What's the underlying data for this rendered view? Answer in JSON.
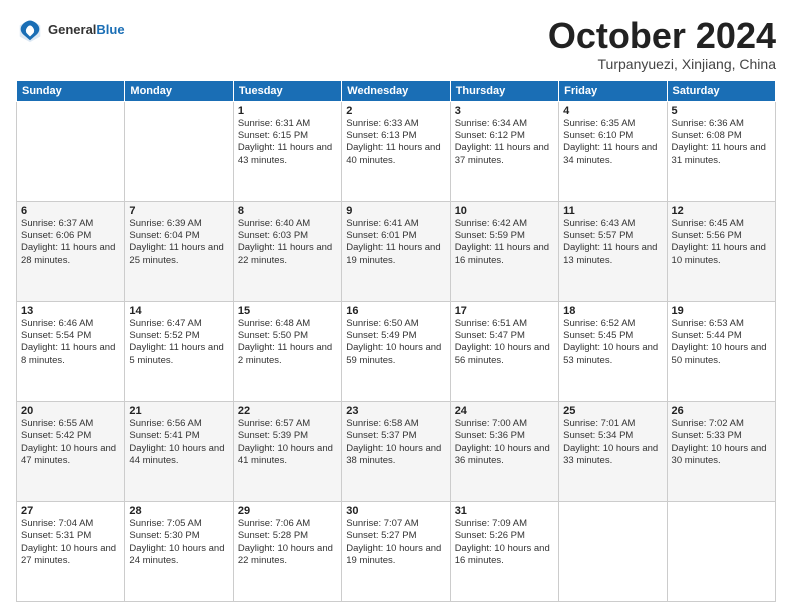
{
  "logo": {
    "general": "General",
    "blue": "Blue"
  },
  "header": {
    "month": "October 2024",
    "location": "Turpanyuezi, Xinjiang, China"
  },
  "weekdays": [
    "Sunday",
    "Monday",
    "Tuesday",
    "Wednesday",
    "Thursday",
    "Friday",
    "Saturday"
  ],
  "weeks": [
    [
      null,
      null,
      {
        "day": "1",
        "sunrise": "6:31 AM",
        "sunset": "6:15 PM",
        "daylight": "11 hours and 43 minutes."
      },
      {
        "day": "2",
        "sunrise": "6:33 AM",
        "sunset": "6:13 PM",
        "daylight": "11 hours and 40 minutes."
      },
      {
        "day": "3",
        "sunrise": "6:34 AM",
        "sunset": "6:12 PM",
        "daylight": "11 hours and 37 minutes."
      },
      {
        "day": "4",
        "sunrise": "6:35 AM",
        "sunset": "6:10 PM",
        "daylight": "11 hours and 34 minutes."
      },
      {
        "day": "5",
        "sunrise": "6:36 AM",
        "sunset": "6:08 PM",
        "daylight": "11 hours and 31 minutes."
      }
    ],
    [
      {
        "day": "6",
        "sunrise": "6:37 AM",
        "sunset": "6:06 PM",
        "daylight": "11 hours and 28 minutes."
      },
      {
        "day": "7",
        "sunrise": "6:39 AM",
        "sunset": "6:04 PM",
        "daylight": "11 hours and 25 minutes."
      },
      {
        "day": "8",
        "sunrise": "6:40 AM",
        "sunset": "6:03 PM",
        "daylight": "11 hours and 22 minutes."
      },
      {
        "day": "9",
        "sunrise": "6:41 AM",
        "sunset": "6:01 PM",
        "daylight": "11 hours and 19 minutes."
      },
      {
        "day": "10",
        "sunrise": "6:42 AM",
        "sunset": "5:59 PM",
        "daylight": "11 hours and 16 minutes."
      },
      {
        "day": "11",
        "sunrise": "6:43 AM",
        "sunset": "5:57 PM",
        "daylight": "11 hours and 13 minutes."
      },
      {
        "day": "12",
        "sunrise": "6:45 AM",
        "sunset": "5:56 PM",
        "daylight": "11 hours and 10 minutes."
      }
    ],
    [
      {
        "day": "13",
        "sunrise": "6:46 AM",
        "sunset": "5:54 PM",
        "daylight": "11 hours and 8 minutes."
      },
      {
        "day": "14",
        "sunrise": "6:47 AM",
        "sunset": "5:52 PM",
        "daylight": "11 hours and 5 minutes."
      },
      {
        "day": "15",
        "sunrise": "6:48 AM",
        "sunset": "5:50 PM",
        "daylight": "11 hours and 2 minutes."
      },
      {
        "day": "16",
        "sunrise": "6:50 AM",
        "sunset": "5:49 PM",
        "daylight": "10 hours and 59 minutes."
      },
      {
        "day": "17",
        "sunrise": "6:51 AM",
        "sunset": "5:47 PM",
        "daylight": "10 hours and 56 minutes."
      },
      {
        "day": "18",
        "sunrise": "6:52 AM",
        "sunset": "5:45 PM",
        "daylight": "10 hours and 53 minutes."
      },
      {
        "day": "19",
        "sunrise": "6:53 AM",
        "sunset": "5:44 PM",
        "daylight": "10 hours and 50 minutes."
      }
    ],
    [
      {
        "day": "20",
        "sunrise": "6:55 AM",
        "sunset": "5:42 PM",
        "daylight": "10 hours and 47 minutes."
      },
      {
        "day": "21",
        "sunrise": "6:56 AM",
        "sunset": "5:41 PM",
        "daylight": "10 hours and 44 minutes."
      },
      {
        "day": "22",
        "sunrise": "6:57 AM",
        "sunset": "5:39 PM",
        "daylight": "10 hours and 41 minutes."
      },
      {
        "day": "23",
        "sunrise": "6:58 AM",
        "sunset": "5:37 PM",
        "daylight": "10 hours and 38 minutes."
      },
      {
        "day": "24",
        "sunrise": "7:00 AM",
        "sunset": "5:36 PM",
        "daylight": "10 hours and 36 minutes."
      },
      {
        "day": "25",
        "sunrise": "7:01 AM",
        "sunset": "5:34 PM",
        "daylight": "10 hours and 33 minutes."
      },
      {
        "day": "26",
        "sunrise": "7:02 AM",
        "sunset": "5:33 PM",
        "daylight": "10 hours and 30 minutes."
      }
    ],
    [
      {
        "day": "27",
        "sunrise": "7:04 AM",
        "sunset": "5:31 PM",
        "daylight": "10 hours and 27 minutes."
      },
      {
        "day": "28",
        "sunrise": "7:05 AM",
        "sunset": "5:30 PM",
        "daylight": "10 hours and 24 minutes."
      },
      {
        "day": "29",
        "sunrise": "7:06 AM",
        "sunset": "5:28 PM",
        "daylight": "10 hours and 22 minutes."
      },
      {
        "day": "30",
        "sunrise": "7:07 AM",
        "sunset": "5:27 PM",
        "daylight": "10 hours and 19 minutes."
      },
      {
        "day": "31",
        "sunrise": "7:09 AM",
        "sunset": "5:26 PM",
        "daylight": "10 hours and 16 minutes."
      },
      null,
      null
    ]
  ],
  "labels": {
    "sunrise": "Sunrise:",
    "sunset": "Sunset:",
    "daylight": "Daylight:"
  }
}
